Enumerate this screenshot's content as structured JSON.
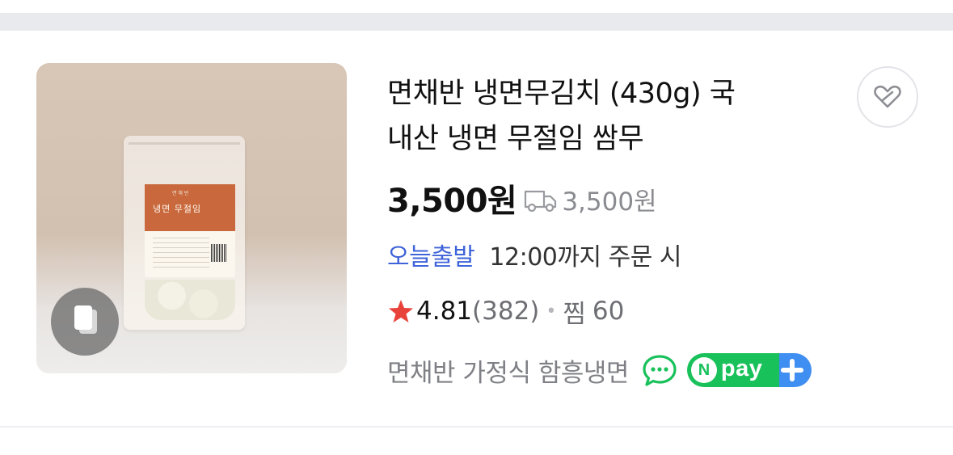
{
  "product": {
    "title_line1": "면채반 냉면무김치 (430g) 국",
    "title_line2": "내산 냉면 무절임 쌈무",
    "price": "3,500원",
    "shipping_fee": "3,500원",
    "delivery_tag": "오늘출발",
    "delivery_text": "12:00까지 주문 시",
    "rating": "4.81",
    "review_count": "(382)",
    "separator": "•",
    "zzim_label": "찜",
    "zzim_count": "60",
    "seller": "면채반 가정식 함흥냉면",
    "npay_letter": "N",
    "npay_text": "pay"
  },
  "package_label": {
    "brand": "면 채 반",
    "name": "냉면 무절임"
  },
  "icons": {
    "wish": "heart-icon",
    "truck": "truck-icon",
    "star": "star-icon",
    "talk": "talk-bubble-icon",
    "npay": "npay-plus-icon",
    "multi_image": "multi-image-icon"
  },
  "colors": {
    "delivery_tag": "#3f63d8",
    "star": "#e8433a",
    "npay_green": "#19c15b",
    "npay_blue": "#3f8ef1",
    "talk_green": "#19c15b"
  }
}
